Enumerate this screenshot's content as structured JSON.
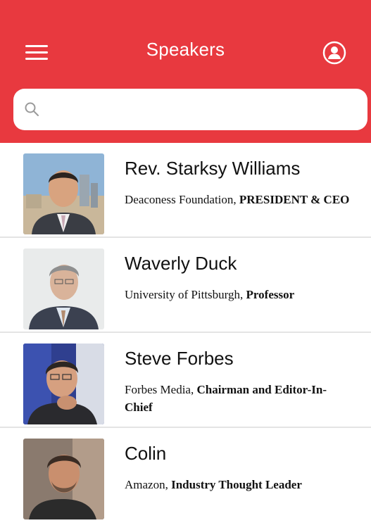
{
  "header": {
    "title": "Speakers",
    "menu_icon": "hamburger-menu-icon",
    "profile_icon": "user-profile-icon",
    "background_color": "#e8393f"
  },
  "search": {
    "value": "",
    "placeholder": "",
    "icon": "search-icon"
  },
  "speakers": [
    {
      "name": "Rev. Starksy Williams",
      "organization": "Deaconess Foundation",
      "role": "PRESIDENT & CEO"
    },
    {
      "name": "Waverly Duck",
      "organization": "University of Pittsburgh",
      "role": "Professor"
    },
    {
      "name": "Steve Forbes",
      "organization": "Forbes Media",
      "role": "Chairman and Editor-In-Chief"
    },
    {
      "name": "Colin",
      "organization": "Amazon",
      "role": "Industry Thought Leader"
    }
  ]
}
